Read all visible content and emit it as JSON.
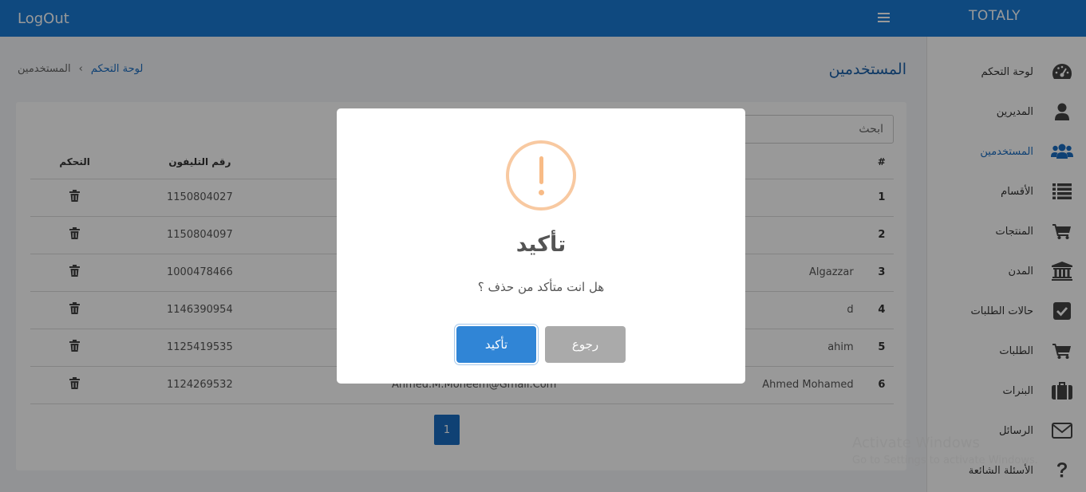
{
  "topbar": {
    "logout_label": "LogOut",
    "brand": "TOTALY",
    "menu_icon": "hamburger-icon",
    "color": "#1a7ad4"
  },
  "sidebar": {
    "items": [
      {
        "label": "لوحة التحكم",
        "icon": "dashboard-icon"
      },
      {
        "label": "المديرين",
        "icon": "user-icon"
      },
      {
        "label": "المستخدمين",
        "icon": "users-icon",
        "active": true
      },
      {
        "label": "الأقسام",
        "icon": "list-icon"
      },
      {
        "label": "المنتجات",
        "icon": "cart-icon"
      },
      {
        "label": "المدن",
        "icon": "bank-icon"
      },
      {
        "label": "حالات الطلبات",
        "icon": "check-square-icon"
      },
      {
        "label": "الطلبات",
        "icon": "cart-icon"
      },
      {
        "label": "البنرات",
        "icon": "briefcase-icon"
      },
      {
        "label": "الرسائل",
        "icon": "envelope-icon"
      },
      {
        "label": "الأسئلة الشائعة",
        "icon": "question-icon"
      }
    ]
  },
  "page": {
    "title": "المستخدمين",
    "breadcrumb": {
      "home": "لوحة التحكم",
      "separator": "›",
      "current": "المستخدمين"
    }
  },
  "search": {
    "placeholder": "ابحث"
  },
  "table": {
    "headers": {
      "num": "#",
      "name": "",
      "email": "",
      "phone": "رقم التليفون",
      "control": "التحكم"
    },
    "rows": [
      {
        "num": "1",
        "name": "",
        "email": "",
        "phone": "1150804027"
      },
      {
        "num": "2",
        "name": "",
        "email": "",
        "phone": "1150804097"
      },
      {
        "num": "3",
        "name": "Algazzar",
        "email": "",
        "phone": "1000478466"
      },
      {
        "num": "4",
        "name": "d",
        "email": "",
        "phone": "1146390954"
      },
      {
        "num": "5",
        "name": "ahim",
        "email": "",
        "phone": "1125419535"
      },
      {
        "num": "6",
        "name": "Ahmed Mohamed",
        "email": "Ahmed.M.Moneem@Gmail.Com",
        "phone": "1124269532"
      }
    ]
  },
  "pagination": {
    "current_page": "1"
  },
  "modal": {
    "icon": "warning-icon",
    "title": "تأكيد",
    "message": "هل انت متأكد من حذف ؟",
    "confirm_label": "تأكيد",
    "cancel_label": "رجوع"
  },
  "watermark": {
    "line1": "Activate Windows",
    "line2": "Go to Settings to activate Windows."
  }
}
